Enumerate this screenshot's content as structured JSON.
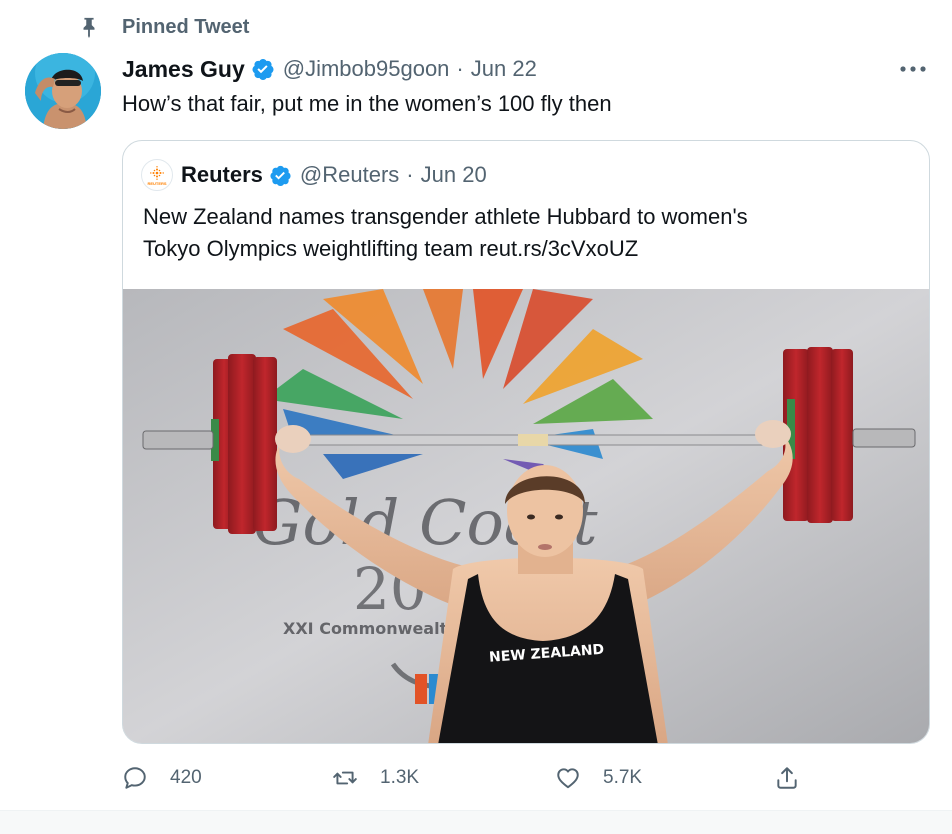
{
  "pinned": {
    "label": "Pinned Tweet",
    "icon": "pin-icon"
  },
  "author": {
    "name": "James Guy",
    "handle": "@Jimbob95goon",
    "date": "Jun 22",
    "verified": true
  },
  "tweet": {
    "text": "How’s that fair, put me in the women’s 100 fly then"
  },
  "quote": {
    "name": "Reuters",
    "handle": "@Reuters",
    "date": "Jun 20",
    "avatar_text": "REUTERS",
    "verified": true,
    "text_lines": [
      "New Zealand names transgender athlete Hubbard to women's",
      "Tokyo Olympics weightlifting team reut.rs/3cVxoUZ"
    ],
    "media": {
      "backdrop_lines": [
        "Gold Coast",
        "20",
        "XXI Commonwealth"
      ],
      "jersey_text": "NEW ZEALAND"
    }
  },
  "actions": {
    "reply_count": "420",
    "retweet_count": "1.3K",
    "like_count": "5.7K"
  },
  "colors": {
    "verified_blue": "#1d9bf0",
    "secondary_text": "#536471",
    "plate_red": "#c0262c"
  }
}
